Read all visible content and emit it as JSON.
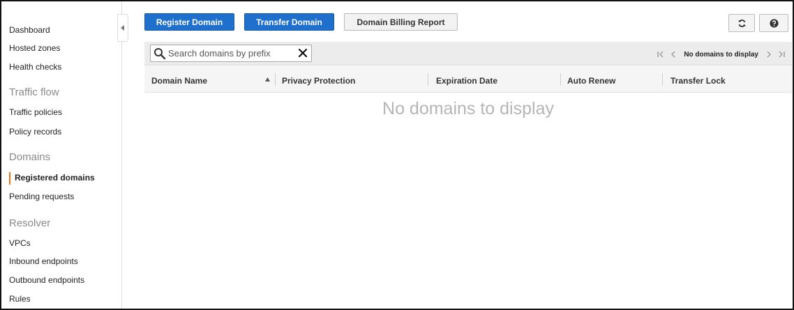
{
  "sidebar": {
    "items": [
      {
        "label": "Dashboard"
      },
      {
        "label": "Hosted zones"
      },
      {
        "label": "Health checks"
      },
      {
        "label": "Traffic flow"
      },
      {
        "label": "Traffic policies"
      },
      {
        "label": "Policy records"
      },
      {
        "label": "Domains"
      },
      {
        "label": "Registered domains"
      },
      {
        "label": "Pending requests"
      },
      {
        "label": "Resolver"
      },
      {
        "label": "VPCs"
      },
      {
        "label": "Inbound endpoints"
      },
      {
        "label": "Outbound endpoints"
      },
      {
        "label": "Rules"
      }
    ],
    "active_accent": "#ec7211"
  },
  "toolbar": {
    "register_label": "Register Domain",
    "transfer_label": "Transfer Domain",
    "billing_label": "Domain Billing Report",
    "refresh_icon": "refresh-icon",
    "help_icon": "help-icon"
  },
  "search": {
    "placeholder": "Search domains by prefix",
    "value": ""
  },
  "pager": {
    "label": "No domains to display"
  },
  "table": {
    "columns": [
      {
        "label": "Domain Name"
      },
      {
        "label": "Privacy Protection"
      },
      {
        "label": "Expiration Date"
      },
      {
        "label": "Auto Renew"
      },
      {
        "label": "Transfer Lock"
      }
    ],
    "sort_column": "Domain Name",
    "empty_message": "No domains to display"
  },
  "colors": {
    "primary_button": "#1f6fcc",
    "header_bg": "#f5f5f5"
  }
}
